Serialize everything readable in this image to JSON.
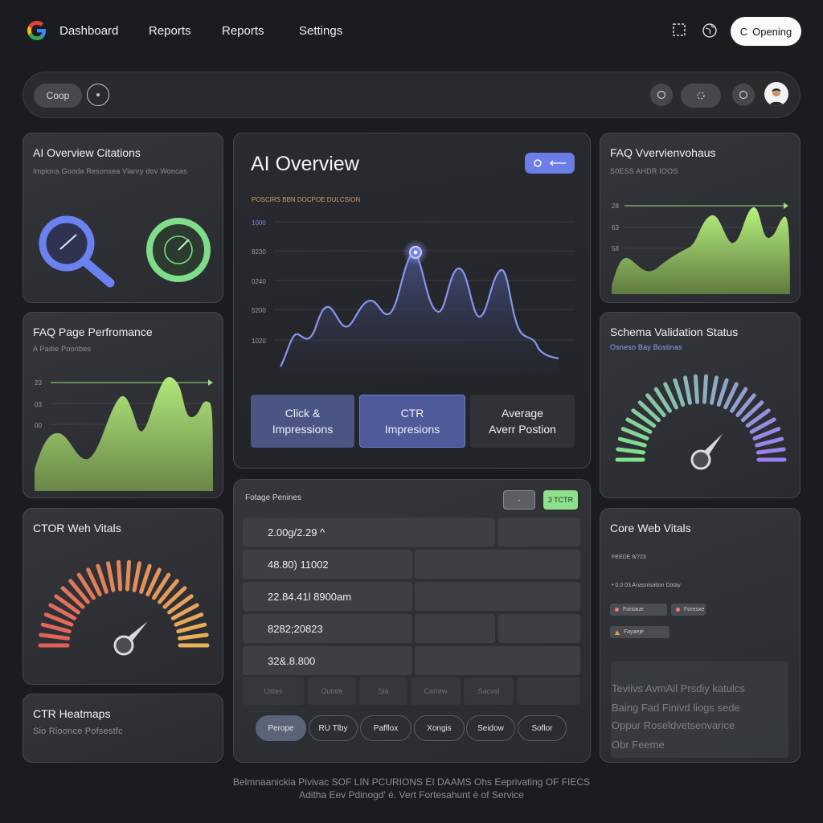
{
  "nav": {
    "links": [
      "Dashboard",
      "Reports",
      "Reports",
      "Settings"
    ],
    "open_button": "Opening",
    "open_button_glyph": "C"
  },
  "toolbar": {
    "chip_label": "Coop"
  },
  "cards": {
    "ai_citations": {
      "title": "AI Overview Citations",
      "subtitle": "Impions Gooda Resonsea Vianry dov Woncas"
    },
    "faq_perf": {
      "title": "FAQ Page Perfromance",
      "subtitle": "A Padie Pooribes",
      "ticks": [
        "23",
        "03",
        "00"
      ]
    },
    "ctor": {
      "title": "CTOR Weh Vitals"
    },
    "ctr_heatmaps": {
      "title": "CTR Heatmaps",
      "subtitle": "Sio Rioonce Pofsestfc"
    },
    "ai_overview": {
      "title": "AI Overview",
      "legend": "POSCIRS BBN DOCPOE DULCSION",
      "ticks": [
        "1000",
        "8230",
        "0240",
        "5200",
        "1020"
      ],
      "metrics": [
        {
          "line1": "Click &",
          "line2": "Impressions"
        },
        {
          "line1": "CTR",
          "line2": "Impresions"
        },
        {
          "line1": "Average",
          "line2": "Averr Postion"
        }
      ]
    },
    "faq_overview": {
      "title": "FAQ Vvervienvohaus",
      "subtitle": "S0ESS AHDR IOOS",
      "ticks": [
        "28",
        "63",
        "58"
      ]
    },
    "schema": {
      "title": "Schema Validation Status",
      "subtitle": "Osneso Bay Bostinas"
    },
    "table": {
      "title": "Fotage Penines",
      "btn_a": "-",
      "btn_b": "3 TCTR",
      "rows": [
        "2.00g/2.29 ^",
        "48.80) 11002",
        "22.84.41l 8900am",
        "8282;20823",
        "32&.8.800"
      ],
      "footer_cells": [
        "Ustes",
        "Outate",
        "Sla",
        "Carrew",
        "Sacval"
      ],
      "pills": [
        "Perope",
        "RU Tlby",
        "Pafflox",
        "Xongis",
        "Seidow",
        "Soflor"
      ]
    },
    "core_web_vitals": {
      "title": "Core Web Vitals",
      "label_a": "FEEDE 8/723",
      "label_b": "• 0.0 03 Anasnisation Dotay",
      "tag_a": "Forsaue",
      "tag_b": "Foresxe",
      "tag_c": "Fayaeje",
      "blur_lines": [
        "Teviivs AvmAil Prsdiy katulcs",
        "Baing Fad Finivd liogs sede",
        "Oppur Roseldvetsenvarice",
        "Obr Feeme"
      ]
    }
  },
  "footer": {
    "line1": "Belmnaanickia Pivivac SOF LIN PCURIONS EI DAAMS Ohs Eeprivating OF FIECS",
    "line2": "Aditha Eev Pdinogd' é. Vert Fortesahunt è of Service"
  },
  "colors": {
    "accent_blue": "#6b7ee8",
    "green_fill": "#a6dc76",
    "gauge_green": "#7fe38b",
    "gauge_purple": "#9a7ef0",
    "gauge_red": "#e0605a",
    "gauge_amber": "#e8b25a"
  }
}
